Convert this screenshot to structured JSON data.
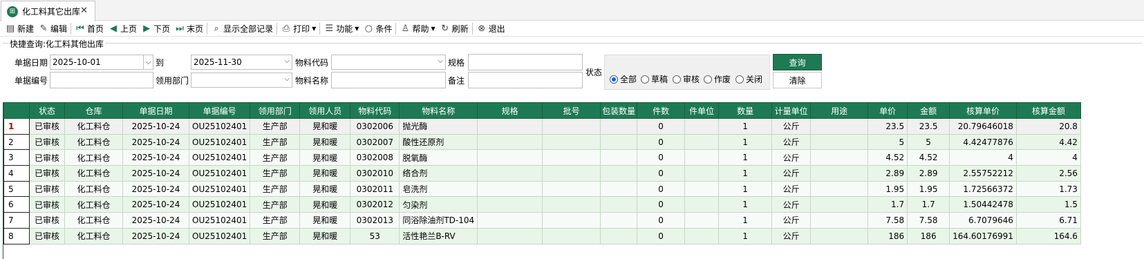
{
  "tab": {
    "title": "化工料其它出库",
    "icon": "ledger-icon"
  },
  "toolbar": {
    "items": [
      {
        "label": "新建",
        "icon": "new-doc-icon"
      },
      {
        "label": "编辑",
        "icon": "edit-icon"
      },
      {
        "label": "首页",
        "icon": "first-page-icon"
      },
      {
        "label": "上页",
        "icon": "prev-page-icon"
      },
      {
        "label": "下页",
        "icon": "next-page-icon"
      },
      {
        "label": "末页",
        "icon": "last-page-icon"
      },
      {
        "label": "显示全部记录",
        "icon": "show-all-icon"
      },
      {
        "label": "打印",
        "icon": "print-icon"
      },
      {
        "label": "功能",
        "icon": "list-icon"
      },
      {
        "label": "条件",
        "icon": "search-icon"
      },
      {
        "label": "帮助",
        "icon": "help-icon"
      },
      {
        "label": "刷新",
        "icon": "refresh-icon"
      },
      {
        "label": "退出",
        "icon": "exit-icon"
      }
    ]
  },
  "query": {
    "title": "快捷查询:化工料其他出库",
    "date_label": "单据日期",
    "date_from": "2025-10-01",
    "to_label": "到",
    "date_to": "2025-11-30",
    "material_code_label": "物料代码",
    "material_code": "",
    "spec_label": "规格",
    "spec": "",
    "doc_no_label": "单据编号",
    "doc_no": "",
    "dept_label": "领用部门",
    "dept": "",
    "material_name_label": "物料名称",
    "material_name": "",
    "remark_label": "备注",
    "remark": "",
    "status_label": "状态",
    "status_options": [
      "全部",
      "草稿",
      "审核",
      "作废",
      "关闭"
    ],
    "status_selected": "全部",
    "query_button": "查询",
    "clear_button": "清除"
  },
  "grid": {
    "columns": [
      "状态",
      "仓库",
      "单据日期",
      "单据编号",
      "领用部门",
      "领用人员",
      "物料代码",
      "物料名称",
      "规格",
      "批号",
      "包装数量",
      "件数",
      "件单位",
      "数量",
      "计量单位",
      "用途",
      "单价",
      "金额",
      "核算单价",
      "核算金额"
    ],
    "rows": [
      {
        "num": "1",
        "cells": [
          "已审核",
          "化工料仓",
          "2025-10-24",
          "OU25102401",
          "生产部",
          "晃和暖",
          "0302006",
          "抛光酶",
          "",
          "",
          "",
          "0",
          "",
          "1",
          "公斤",
          "",
          "23.5",
          "23.5",
          "20.79646018",
          "20.8"
        ]
      },
      {
        "num": "2",
        "cells": [
          "已审核",
          "化工料仓",
          "2025-10-24",
          "OU25102401",
          "生产部",
          "晃和暖",
          "0302007",
          "酸性还原剂",
          "",
          "",
          "",
          "0",
          "",
          "1",
          "公斤",
          "",
          "5",
          "5",
          "4.42477876",
          "4.42"
        ]
      },
      {
        "num": "3",
        "cells": [
          "已审核",
          "化工料仓",
          "2025-10-24",
          "OU25102401",
          "生产部",
          "晃和暖",
          "0302008",
          "脱氧酶",
          "",
          "",
          "",
          "0",
          "",
          "1",
          "公斤",
          "",
          "4.52",
          "4.52",
          "4",
          "4"
        ]
      },
      {
        "num": "4",
        "cells": [
          "已审核",
          "化工料仓",
          "2025-10-24",
          "OU25102401",
          "生产部",
          "晃和暖",
          "0302010",
          "络合剂",
          "",
          "",
          "",
          "0",
          "",
          "1",
          "公斤",
          "",
          "2.89",
          "2.89",
          "2.55752212",
          "2.56"
        ]
      },
      {
        "num": "5",
        "cells": [
          "已审核",
          "化工料仓",
          "2025-10-24",
          "OU25102401",
          "生产部",
          "晃和暖",
          "0302011",
          "皂洗剂",
          "",
          "",
          "",
          "0",
          "",
          "1",
          "公斤",
          "",
          "1.95",
          "1.95",
          "1.72566372",
          "1.73"
        ]
      },
      {
        "num": "6",
        "cells": [
          "已审核",
          "化工料仓",
          "2025-10-24",
          "OU25102401",
          "生产部",
          "晃和暖",
          "0302012",
          "匀染剂",
          "",
          "",
          "",
          "0",
          "",
          "1",
          "公斤",
          "",
          "1.7",
          "1.7",
          "1.50442478",
          "1.5"
        ]
      },
      {
        "num": "7",
        "cells": [
          "已审核",
          "化工料仓",
          "2025-10-24",
          "OU25102401",
          "生产部",
          "晃和暖",
          "0302013",
          "同浴除油剂TD-104",
          "",
          "",
          "",
          "0",
          "",
          "1",
          "公斤",
          "",
          "7.58",
          "7.58",
          "6.7079646",
          "6.71"
        ]
      },
      {
        "num": "8",
        "cells": [
          "已审核",
          "化工料仓",
          "2025-10-24",
          "OU25102401",
          "生产部",
          "晃和暖",
          "53",
          "活性艳兰B-RV",
          "",
          "",
          "",
          "0",
          "",
          "1",
          "公斤",
          "",
          "186",
          "186",
          "164.60176991",
          "164.6"
        ]
      }
    ]
  }
}
